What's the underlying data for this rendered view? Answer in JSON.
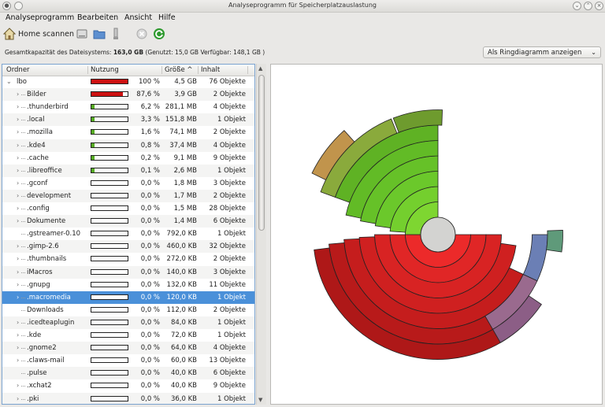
{
  "window": {
    "title": "Analyseprogramm für Speicherplatzauslastung"
  },
  "menu": [
    "Analyseprogramm",
    "Bearbeiten",
    "Ansicht",
    "Hilfe"
  ],
  "toolbar": {
    "home_scan_label": "Home scannen"
  },
  "info": {
    "capacity_prefix": "Gesamtkapazität des Dateisystems:",
    "capacity_value": "163,0 GB",
    "capacity_suffix": "(Genutzt: 15,0 GB Verfügbar: 148,1 GB )"
  },
  "view_select": {
    "selected": "Als Ringdiagramm anzeigen"
  },
  "table": {
    "headers": {
      "folder": "Ordner",
      "usage": "Nutzung",
      "size": "Größe",
      "content": "Inhalt"
    },
    "sort_indicator": "^",
    "rows": [
      {
        "name": "lbo",
        "pct": "100 %",
        "size": "4,5 GB",
        "count": "76 Objekte",
        "usage": 1.0,
        "bar_color": "#cc1111",
        "level": 0,
        "expander": "⌄"
      },
      {
        "name": "Bilder",
        "pct": "87,6 %",
        "size": "3,9 GB",
        "count": "2 Objekte",
        "usage": 0.876,
        "bar_color": "#cc1111",
        "level": 1,
        "expander": "›"
      },
      {
        "name": ".thunderbird",
        "pct": "6,2 %",
        "size": "281,1 MB",
        "count": "4 Objekte",
        "usage": 0.062,
        "bar_color": "#55aa22",
        "level": 1,
        "expander": "›"
      },
      {
        "name": ".local",
        "pct": "3,3 %",
        "size": "151,8 MB",
        "count": "1 Objekt",
        "usage": 0.033,
        "bar_color": "#55aa22",
        "level": 1,
        "expander": "›"
      },
      {
        "name": ".mozilla",
        "pct": "1,6 %",
        "size": "74,1 MB",
        "count": "2 Objekte",
        "usage": 0.016,
        "bar_color": "#55aa22",
        "level": 1,
        "expander": "›"
      },
      {
        "name": ".kde4",
        "pct": "0,8 %",
        "size": "37,4 MB",
        "count": "4 Objekte",
        "usage": 0.008,
        "bar_color": "#55aa22",
        "level": 1,
        "expander": "›"
      },
      {
        "name": ".cache",
        "pct": "0,2 %",
        "size": "9,1 MB",
        "count": "9 Objekte",
        "usage": 0.002,
        "bar_color": "#55aa22",
        "level": 1,
        "expander": "›"
      },
      {
        "name": ".libreoffice",
        "pct": "0,1 %",
        "size": "2,6 MB",
        "count": "1 Objekt",
        "usage": 0.001,
        "bar_color": "#55aa22",
        "level": 1,
        "expander": "›"
      },
      {
        "name": ".gconf",
        "pct": "0,0 %",
        "size": "1,8 MB",
        "count": "3 Objekte",
        "usage": 0,
        "bar_color": "#55aa22",
        "level": 1,
        "expander": "›"
      },
      {
        "name": "development",
        "pct": "0,0 %",
        "size": "1,7 MB",
        "count": "2 Objekte",
        "usage": 0,
        "bar_color": "#55aa22",
        "level": 1,
        "expander": "›"
      },
      {
        "name": ".config",
        "pct": "0,0 %",
        "size": "1,5 MB",
        "count": "28 Objekte",
        "usage": 0,
        "bar_color": "#55aa22",
        "level": 1,
        "expander": "›"
      },
      {
        "name": "Dokumente",
        "pct": "0,0 %",
        "size": "1,4 MB",
        "count": "6 Objekte",
        "usage": 0,
        "bar_color": "#55aa22",
        "level": 1,
        "expander": "›"
      },
      {
        "name": ".gstreamer-0.10",
        "pct": "0,0 %",
        "size": "792,0 KB",
        "count": "1 Objekt",
        "usage": 0,
        "bar_color": "#55aa22",
        "level": 1,
        "expander": ""
      },
      {
        "name": ".gimp-2.6",
        "pct": "0,0 %",
        "size": "460,0 KB",
        "count": "32 Objekte",
        "usage": 0,
        "bar_color": "#55aa22",
        "level": 1,
        "expander": "›"
      },
      {
        "name": ".thumbnails",
        "pct": "0,0 %",
        "size": "272,0 KB",
        "count": "2 Objekte",
        "usage": 0,
        "bar_color": "#55aa22",
        "level": 1,
        "expander": "›"
      },
      {
        "name": "iMacros",
        "pct": "0,0 %",
        "size": "140,0 KB",
        "count": "3 Objekte",
        "usage": 0,
        "bar_color": "#55aa22",
        "level": 1,
        "expander": "›"
      },
      {
        "name": ".gnupg",
        "pct": "0,0 %",
        "size": "132,0 KB",
        "count": "11 Objekte",
        "usage": 0,
        "bar_color": "#55aa22",
        "level": 1,
        "expander": "›"
      },
      {
        "name": ".macromedia",
        "pct": "0,0 %",
        "size": "120,0 KB",
        "count": "1 Objekt",
        "usage": 0,
        "bar_color": "#55aa22",
        "level": 1,
        "expander": "›",
        "selected": true
      },
      {
        "name": "Downloads",
        "pct": "0,0 %",
        "size": "112,0 KB",
        "count": "2 Objekte",
        "usage": 0,
        "bar_color": "#55aa22",
        "level": 1,
        "expander": ""
      },
      {
        "name": ".icedteaplugin",
        "pct": "0,0 %",
        "size": "84,0 KB",
        "count": "1 Objekt",
        "usage": 0,
        "bar_color": "#55aa22",
        "level": 1,
        "expander": "›"
      },
      {
        "name": ".kde",
        "pct": "0,0 %",
        "size": "72,0 KB",
        "count": "1 Objekt",
        "usage": 0,
        "bar_color": "#55aa22",
        "level": 1,
        "expander": "›"
      },
      {
        "name": ".gnome2",
        "pct": "0,0 %",
        "size": "64,0 KB",
        "count": "4 Objekte",
        "usage": 0,
        "bar_color": "#55aa22",
        "level": 1,
        "expander": "›"
      },
      {
        "name": ".claws-mail",
        "pct": "0,0 %",
        "size": "60,0 KB",
        "count": "13 Objekte",
        "usage": 0,
        "bar_color": "#55aa22",
        "level": 1,
        "expander": "›"
      },
      {
        "name": ".pulse",
        "pct": "0,0 %",
        "size": "40,0 KB",
        "count": "6 Objekte",
        "usage": 0,
        "bar_color": "#55aa22",
        "level": 1,
        "expander": ""
      },
      {
        "name": ".xchat2",
        "pct": "0,0 %",
        "size": "40,0 KB",
        "count": "9 Objekte",
        "usage": 0,
        "bar_color": "#55aa22",
        "level": 1,
        "expander": "›"
      },
      {
        "name": ".pki",
        "pct": "0,0 %",
        "size": "36,0 KB",
        "count": "1 Objekt",
        "usage": 0,
        "bar_color": "#55aa22",
        "level": 1,
        "expander": "›"
      }
    ]
  },
  "ring_chart": {
    "center_color": "#d3d3d1",
    "segments": [
      {
        "depth": 1,
        "start": 180,
        "end": 360,
        "color": "#ec2a2a"
      },
      {
        "depth": 1,
        "start": 90,
        "end": 180,
        "color": "#7ed631"
      },
      {
        "depth": 2,
        "start": 180,
        "end": 360,
        "color": "#e02626"
      },
      {
        "depth": 2,
        "start": 90,
        "end": 176,
        "color": "#74cf2e"
      },
      {
        "depth": 3,
        "start": 180,
        "end": 360,
        "color": "#d82323"
      },
      {
        "depth": 3,
        "start": 90,
        "end": 172,
        "color": "#6bc82b"
      },
      {
        "depth": 4,
        "start": 182,
        "end": 352,
        "color": "#cf2020"
      },
      {
        "depth": 4,
        "start": 90,
        "end": 170,
        "color": "#66c128"
      },
      {
        "depth": 5,
        "start": 183,
        "end": 335,
        "color": "#c51d1d"
      },
      {
        "depth": 5,
        "start": 90,
        "end": 168,
        "color": "#62bb26"
      },
      {
        "depth": 6,
        "start": 185,
        "end": 320,
        "color": "#b81a1a"
      },
      {
        "depth": 6,
        "start": 90,
        "end": 160,
        "color": "#5fb224"
      },
      {
        "depth": 7,
        "start": 187,
        "end": 310,
        "color": "#ae1818"
      },
      {
        "depth": 7,
        "start": 112,
        "end": 160,
        "color": "#8aaa3c"
      },
      {
        "depth": 7,
        "start": 88,
        "end": 111,
        "color": "#6e9b2e"
      },
      {
        "depth": 6,
        "start": 300,
        "end": 335,
        "color": "#9a6a8e"
      },
      {
        "depth": 7,
        "start": 300,
        "end": 326,
        "color": "#8c5e86"
      },
      {
        "depth": 6,
        "start": 335,
        "end": 360,
        "color": "#6b7fb5"
      },
      {
        "depth": 7,
        "start": 352,
        "end": 362,
        "color": "#5f9a7a"
      },
      {
        "depth": 8,
        "start": 132,
        "end": 154,
        "color": "#c1944c"
      }
    ]
  }
}
